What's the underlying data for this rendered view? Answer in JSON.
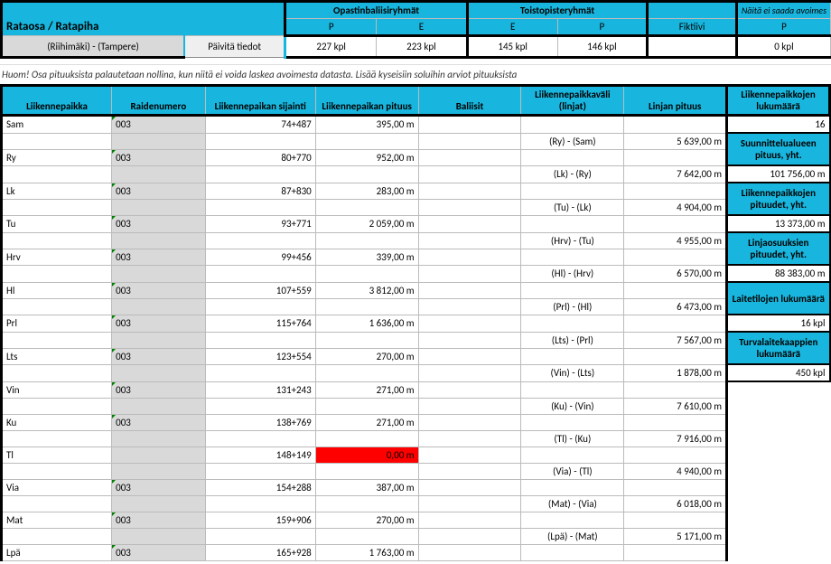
{
  "colors": {
    "teal": "#18b6de",
    "gray": "#d9d9d9",
    "red": "#ff0000"
  },
  "top": {
    "title": "Rataosa / Ratapiha",
    "section_input": "(Riihimäki) - (Tampere)",
    "update_button": "Päivitä tiedot",
    "groups": {
      "opastin": {
        "label": "Opastinbaliisiryhmät",
        "sub1": "P",
        "sub2": "E",
        "val1": "227 kpl",
        "val2": "223 kpl"
      },
      "toisto": {
        "label": "Toistopisteryhmät",
        "sub1": "E",
        "sub2": "P",
        "val1": "145 kpl",
        "val2": "146 kpl"
      },
      "fikti": {
        "label_top": "Näitä ei saada avoimes",
        "label": "Fiktiivi",
        "sub1": "P",
        "val1": "0 kpl"
      }
    }
  },
  "note": "Huom! Osa pituuksista palautetaan nollina, kun niitä ei voida laskea avoimesta datasta. Lisää kyseisiin soluihin arviot pituuksista",
  "headers": {
    "c1": "Liikennepaikka",
    "c2": "Raidenumero",
    "c3": "Liikennepaikan sijainti",
    "c4": "Liikennepaikan pituus",
    "c5": "Baliisit",
    "c6": "Liikennepaikkaväli (linjat)",
    "c7": "Linjan pituus",
    "c8": "Liikennepaikkojen lukumäärä"
  },
  "summary": [
    {
      "label": "",
      "value": "16",
      "highlight": false
    },
    {
      "label": "Suunnittelualueen pituus, yht.",
      "value": "101 756,00 m",
      "highlight": true
    },
    {
      "label": "Liikennepaikkojen pituudet, yht.",
      "value": "13 373,00 m",
      "highlight": true
    },
    {
      "label": "Linjaosuuksien pituudet, yht.",
      "value": "88 383,00 m",
      "highlight": true
    },
    {
      "label": "Laitetilojen lukumäärä",
      "value": "16 kpl",
      "highlight": true
    },
    {
      "label": "Turvalaitekaappien lukumäärä",
      "value": "450 kpl",
      "highlight": true
    }
  ],
  "rows": [
    {
      "lp": "Sam",
      "rn": "003",
      "sij": "74+487",
      "pit": "395,00 m",
      "link": "",
      "linkpit": ""
    },
    {
      "lp": "",
      "rn": "",
      "sij": "",
      "pit": "",
      "link": "(Ry) - (Sam)",
      "linkpit": "5 639,00 m"
    },
    {
      "lp": "Ry",
      "rn": "003",
      "sij": "80+770",
      "pit": "952,00 m",
      "link": "",
      "linkpit": ""
    },
    {
      "lp": "",
      "rn": "",
      "sij": "",
      "pit": "",
      "link": "(Lk) - (Ry)",
      "linkpit": "7 642,00 m"
    },
    {
      "lp": "Lk",
      "rn": "003",
      "sij": "87+830",
      "pit": "283,00 m",
      "link": "",
      "linkpit": ""
    },
    {
      "lp": "",
      "rn": "",
      "sij": "",
      "pit": "",
      "link": "(Tu) - (Lk)",
      "linkpit": "4 904,00 m"
    },
    {
      "lp": "Tu",
      "rn": "003",
      "sij": "93+771",
      "pit": "2 059,00 m",
      "link": "",
      "linkpit": ""
    },
    {
      "lp": "",
      "rn": "",
      "sij": "",
      "pit": "",
      "link": "(Hrv) - (Tu)",
      "linkpit": "4 955,00 m"
    },
    {
      "lp": "Hrv",
      "rn": "003",
      "sij": "99+456",
      "pit": "339,00 m",
      "link": "",
      "linkpit": ""
    },
    {
      "lp": "",
      "rn": "",
      "sij": "",
      "pit": "",
      "link": "(Hl) - (Hrv)",
      "linkpit": "6 570,00 m"
    },
    {
      "lp": "Hl",
      "rn": "003",
      "sij": "107+559",
      "pit": "3 812,00 m",
      "link": "",
      "linkpit": ""
    },
    {
      "lp": "",
      "rn": "",
      "sij": "",
      "pit": "",
      "link": "(Prl) - (Hl)",
      "linkpit": "6 473,00 m"
    },
    {
      "lp": "Prl",
      "rn": "003",
      "sij": "115+764",
      "pit": "1 636,00 m",
      "link": "",
      "linkpit": ""
    },
    {
      "lp": "",
      "rn": "",
      "sij": "",
      "pit": "",
      "link": "(Lts) - (Prl)",
      "linkpit": "7 567,00 m"
    },
    {
      "lp": "Lts",
      "rn": "003",
      "sij": "123+554",
      "pit": "270,00 m",
      "link": "",
      "linkpit": ""
    },
    {
      "lp": "",
      "rn": "",
      "sij": "",
      "pit": "",
      "link": "(Vin) - (Lts)",
      "linkpit": "1 878,00 m"
    },
    {
      "lp": "Vin",
      "rn": "003",
      "sij": "131+243",
      "pit": "271,00 m",
      "link": "",
      "linkpit": ""
    },
    {
      "lp": "",
      "rn": "",
      "sij": "",
      "pit": "",
      "link": "(Ku) - (Vin)",
      "linkpit": "7 610,00 m"
    },
    {
      "lp": "Ku",
      "rn": "003",
      "sij": "138+769",
      "pit": "271,00 m",
      "link": "",
      "linkpit": ""
    },
    {
      "lp": "",
      "rn": "",
      "sij": "",
      "pit": "",
      "link": "(Tl) - (Ku)",
      "linkpit": "7 916,00 m"
    },
    {
      "lp": "Tl",
      "rn": "",
      "sij": "148+149",
      "pit": "0,00 m",
      "link": "",
      "linkpit": "",
      "red": true
    },
    {
      "lp": "",
      "rn": "",
      "sij": "",
      "pit": "",
      "link": "(Via) - (Tl)",
      "linkpit": "4 940,00 m"
    },
    {
      "lp": "Via",
      "rn": "003",
      "sij": "154+288",
      "pit": "387,00 m",
      "link": "",
      "linkpit": ""
    },
    {
      "lp": "",
      "rn": "",
      "sij": "",
      "pit": "",
      "link": "(Mat) - (Via)",
      "linkpit": "6 018,00 m"
    },
    {
      "lp": "Mat",
      "rn": "003",
      "sij": "159+906",
      "pit": "270,00 m",
      "link": "",
      "linkpit": ""
    },
    {
      "lp": "",
      "rn": "",
      "sij": "",
      "pit": "",
      "link": "(Lpä) - (Mat)",
      "linkpit": "5 171,00 m"
    },
    {
      "lp": "Lpä",
      "rn": "003",
      "sij": "165+928",
      "pit": "1 763,00 m",
      "link": "",
      "linkpit": ""
    }
  ]
}
